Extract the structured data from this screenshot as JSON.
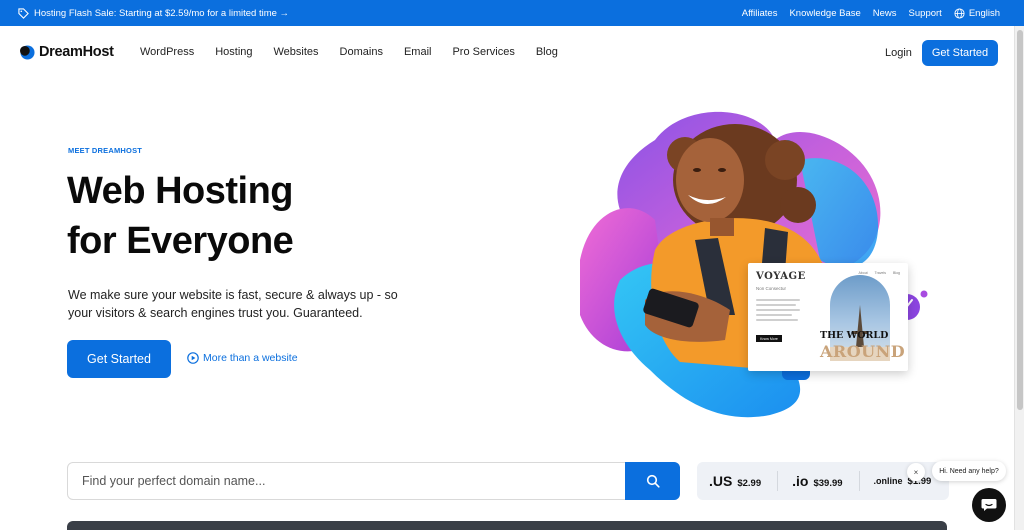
{
  "promo": {
    "text": "Hosting Flash Sale: Starting at $2.59/mo for a limited time →",
    "links": [
      "Affiliates",
      "Knowledge Base",
      "News",
      "Support"
    ],
    "language": "English"
  },
  "header": {
    "brand": "DreamHost",
    "nav": [
      "WordPress",
      "Hosting",
      "Websites",
      "Domains",
      "Email",
      "Pro Services",
      "Blog"
    ],
    "login": "Login",
    "cta": "Get Started"
  },
  "hero": {
    "eyebrow": "MEET DREAMHOST",
    "title_line1": "Web Hosting",
    "title_line2": "for Everyone",
    "subtitle_line1": "We make sure your website is fast, secure & always up - so",
    "subtitle_line2": "your visitors & search engines trust you. Guaranteed.",
    "cta": "Get Started",
    "secondary_link": "More than a website"
  },
  "card": {
    "title": "VOYAGE",
    "subtitle": "Non Consectur",
    "nav": [
      "About",
      "Travels",
      "Blog"
    ],
    "button": "Know More",
    "big1": "THE WORLD",
    "big2": "AROUND"
  },
  "search": {
    "placeholder": "Find your perfect domain name..."
  },
  "tlds": [
    {
      "name": ".US",
      "price": "$2.99"
    },
    {
      "name": ".io",
      "price": "$39.99"
    },
    {
      "name": ".online",
      "price": "$1.99"
    }
  ],
  "chat": {
    "prompt": "Hi. Need any help?",
    "close": "×"
  },
  "colors": {
    "brand_blue": "#0b6fde",
    "dark": "#111111"
  }
}
